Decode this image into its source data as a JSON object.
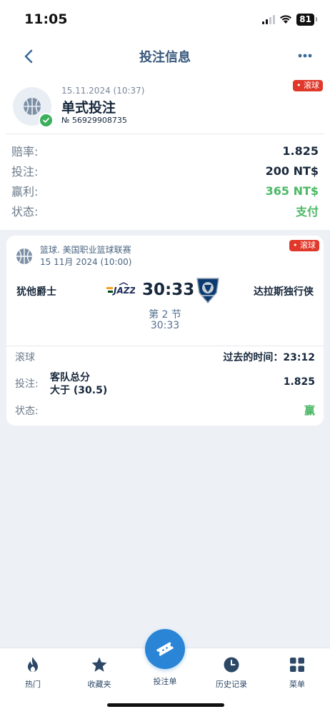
{
  "status_bar": {
    "time": "11:05",
    "battery": "81"
  },
  "nav": {
    "title": "投注信息"
  },
  "summary": {
    "live_badge": "• 滚球",
    "date": "15.11.2024 (10:37)",
    "bet_type": "单式投注",
    "bet_number": "№ 56929908735",
    "rows": [
      {
        "label": "赔率:",
        "value": "1.825",
        "highlight": false
      },
      {
        "label": "投注:",
        "value": "200 NT$",
        "highlight": false
      },
      {
        "label": "赢利:",
        "value": "365 NT$",
        "highlight": true
      },
      {
        "label": "状态:",
        "value": "支付",
        "highlight": true
      }
    ]
  },
  "event": {
    "live_badge": "• 滚球",
    "league": "篮球. 美国职业篮球联赛",
    "date": "15 11月 2024 (10:00)",
    "home_team": "犹他爵士",
    "away_team": "达拉斯独行侠",
    "score": "30:33",
    "period": "第 2 节",
    "period_time": "30:33",
    "mode": "滚球",
    "elapsed_label": "过去的时间：",
    "elapsed_value": "23:12",
    "bet_label": "投注:",
    "bet_market": "客队总分",
    "bet_outcome": "大于 (30.5)",
    "odds": "1.825",
    "status_label": "状态:",
    "status_value": "赢"
  },
  "tabbar": {
    "items": [
      {
        "label": "热门",
        "icon": "flame-icon"
      },
      {
        "label": "收藏夹",
        "icon": "star-icon"
      },
      {
        "label": "投注单",
        "icon": "ticket-icon"
      },
      {
        "label": "历史记录",
        "icon": "clock-icon"
      },
      {
        "label": "菜单",
        "icon": "grid-icon"
      }
    ]
  },
  "colors": {
    "accent": "#2a85d6",
    "win": "#4cb866",
    "live": "#e0392b",
    "title": "#37587c"
  }
}
